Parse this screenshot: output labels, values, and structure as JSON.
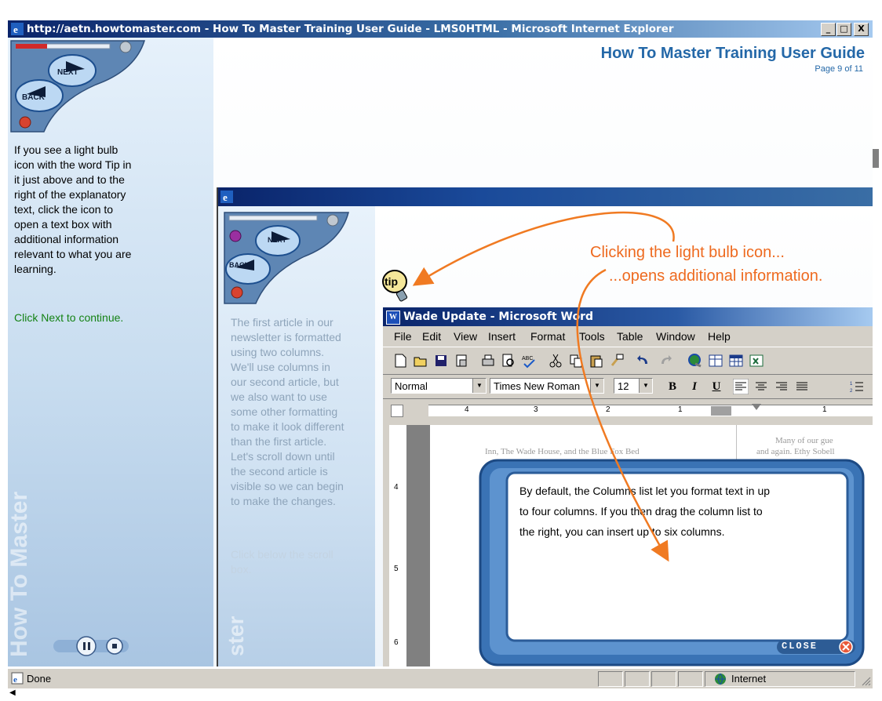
{
  "browser": {
    "title": "http://aetn.howtomaster.com - How To Master Training User Guide - LMS0HTML - Microsoft Internet Explorer",
    "window_buttons": [
      "_",
      "□",
      "X"
    ],
    "status_text": "Done",
    "zone_text": "Internet"
  },
  "guide": {
    "title": "How To Master Training User Guide",
    "page_indicator": "Page 9 of 11",
    "nav": {
      "next": "NEXT",
      "back": "BACK"
    },
    "instruction_lines": [
      "If you see a light bulb",
      "icon with the word Tip in",
      "it just above and to the",
      "right of the explanatory",
      "text, click the icon to",
      "open a text box with",
      "additional information",
      "relevant to what you are",
      "learning."
    ],
    "continue_text": "Click Next to continue.",
    "watermark": "How To Master"
  },
  "inner": {
    "nav": {
      "next": "NEXT",
      "back": "BACK"
    },
    "text_lines": [
      "The first article in our",
      "newsletter is formatted",
      "using two columns.",
      "We'll use columns in",
      "our second article, but",
      "we also want to use",
      "some other formatting",
      "to make it look different",
      "than the first article.",
      "Let's scroll down until",
      "the second article is",
      "visible so we can begin",
      "to make the changes."
    ],
    "click_lines": [
      "Click below the scroll",
      "box."
    ],
    "watermark": "ster"
  },
  "annotations": {
    "line1": "Clicking the light bulb icon...",
    "line2": "...opens additional information.",
    "tip_label": "tip",
    "arrow_color": "#f07a22"
  },
  "word": {
    "title": "Wade Update - Microsoft Word",
    "menu": [
      "File",
      "Edit",
      "View",
      "Insert",
      "Format",
      "Tools",
      "Table",
      "Window",
      "Help"
    ],
    "style": "Normal",
    "font": "Times New Roman",
    "size": "12",
    "bold": "B",
    "italic": "I",
    "underline": "U",
    "ruler_numbers": [
      "4",
      "3",
      "2",
      "1",
      "1"
    ],
    "vruler_numbers": [
      "4",
      "5",
      "6"
    ],
    "doc_text_left": "Inn, The Wade House, and the Blue Fox Bed",
    "doc_text_right": "and again. Ethy Sobell",
    "doc_text_top": "Many of our gue"
  },
  "popup": {
    "lines": [
      "By default, the Columns list let you format text in up",
      "to four columns. If you then drag the column list to",
      "the right, you can insert up to six columns."
    ],
    "close_label": "CLOSE"
  }
}
